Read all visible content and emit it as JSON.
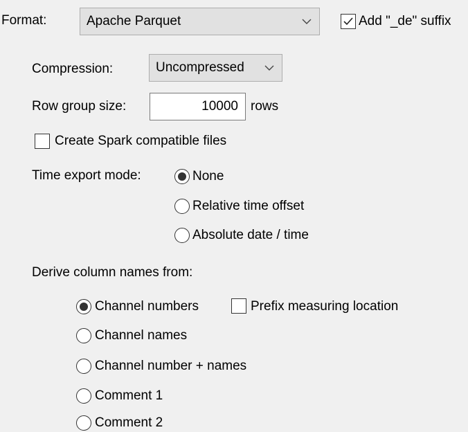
{
  "format": {
    "label": "Format:",
    "selected": "Apache Parquet",
    "suffix_checkbox": {
      "label": "Add \"_de\" suffix",
      "checked": true
    }
  },
  "compression": {
    "label": "Compression:",
    "selected": "Uncompressed"
  },
  "row_group": {
    "label": "Row group size:",
    "value": "10000",
    "unit": "rows"
  },
  "spark": {
    "label": "Create Spark compatible files",
    "checked": false
  },
  "time_export": {
    "label": "Time export mode:",
    "options": [
      {
        "label": "None",
        "selected": true
      },
      {
        "label": "Relative time offset",
        "selected": false
      },
      {
        "label": "Absolute date / time",
        "selected": false
      }
    ]
  },
  "derive": {
    "label": "Derive column names from:",
    "options": [
      {
        "label": "Channel numbers",
        "selected": true
      },
      {
        "label": "Channel names",
        "selected": false
      },
      {
        "label": "Channel number + names",
        "selected": false
      },
      {
        "label": "Comment 1",
        "selected": false
      },
      {
        "label": "Comment 2",
        "selected": false
      }
    ],
    "prefix_checkbox": {
      "label": "Prefix measuring location",
      "checked": false
    }
  }
}
